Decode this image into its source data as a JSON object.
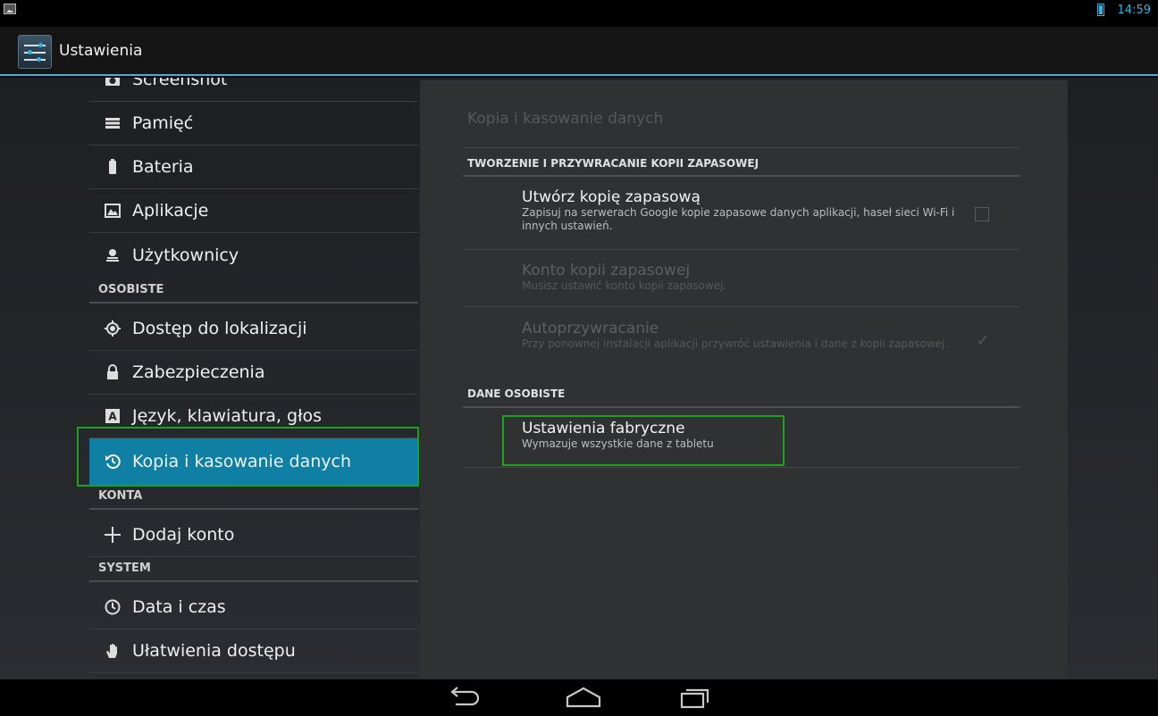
{
  "status_bar": {
    "time": "14:59"
  },
  "action_bar": {
    "title": "Ustawienia"
  },
  "left_menu": {
    "items": [
      {
        "label": "Screenshot",
        "icon": "camera-icon"
      },
      {
        "label": "Pamięć",
        "icon": "storage-icon"
      },
      {
        "label": "Bateria",
        "icon": "battery-icon"
      },
      {
        "label": "Aplikacje",
        "icon": "apps-icon"
      },
      {
        "label": "Użytkownicy",
        "icon": "user-icon"
      },
      {
        "label": "Dostęp do lokalizacji",
        "icon": "location-icon"
      },
      {
        "label": "Zabezpieczenia",
        "icon": "lock-icon"
      },
      {
        "label": "Język, klawiatura, głos",
        "icon": "language-icon"
      },
      {
        "label": "Kopia i kasowanie danych",
        "icon": "backup-icon",
        "selected": true
      },
      {
        "label": "Dodaj konto",
        "icon": "plus-icon"
      },
      {
        "label": "Data i czas",
        "icon": "clock-icon"
      },
      {
        "label": "Ułatwienia dostępu",
        "icon": "hand-icon"
      }
    ],
    "sections": {
      "personal": "OSOBISTE",
      "accounts": "KONTA",
      "system": "SYSTEM"
    }
  },
  "detail": {
    "title": "Kopia i kasowanie danych",
    "backup_section": "TWORZENIE I PRZYWRACANIE KOPII ZAPASOWEJ",
    "backup_data": {
      "title": "Utwórz kopię zapasową",
      "summary": "Zapisuj na serwerach Google kopie zapasowe danych aplikacji, haseł sieci Wi-Fi i innych ustawień.",
      "checked": false
    },
    "backup_account": {
      "title": "Konto kopii zapasowej",
      "summary": "Musisz ustawić konto kopii zapasowej."
    },
    "auto_restore": {
      "title": "Autoprzywracanie",
      "summary": "Przy ponownej instalacji aplikacji przywróć ustawienia i dane z kopii zapasowej.",
      "checked": true
    },
    "personal_section": "DANE OSOBISTE",
    "factory_reset": {
      "title": "Ustawienia fabryczne",
      "summary": "Wymazuje wszystkie dane z tabletu"
    }
  },
  "colors": {
    "accent": "#33b5e5",
    "selected": "#0f7fa3",
    "highlight": "#1fa01f"
  }
}
